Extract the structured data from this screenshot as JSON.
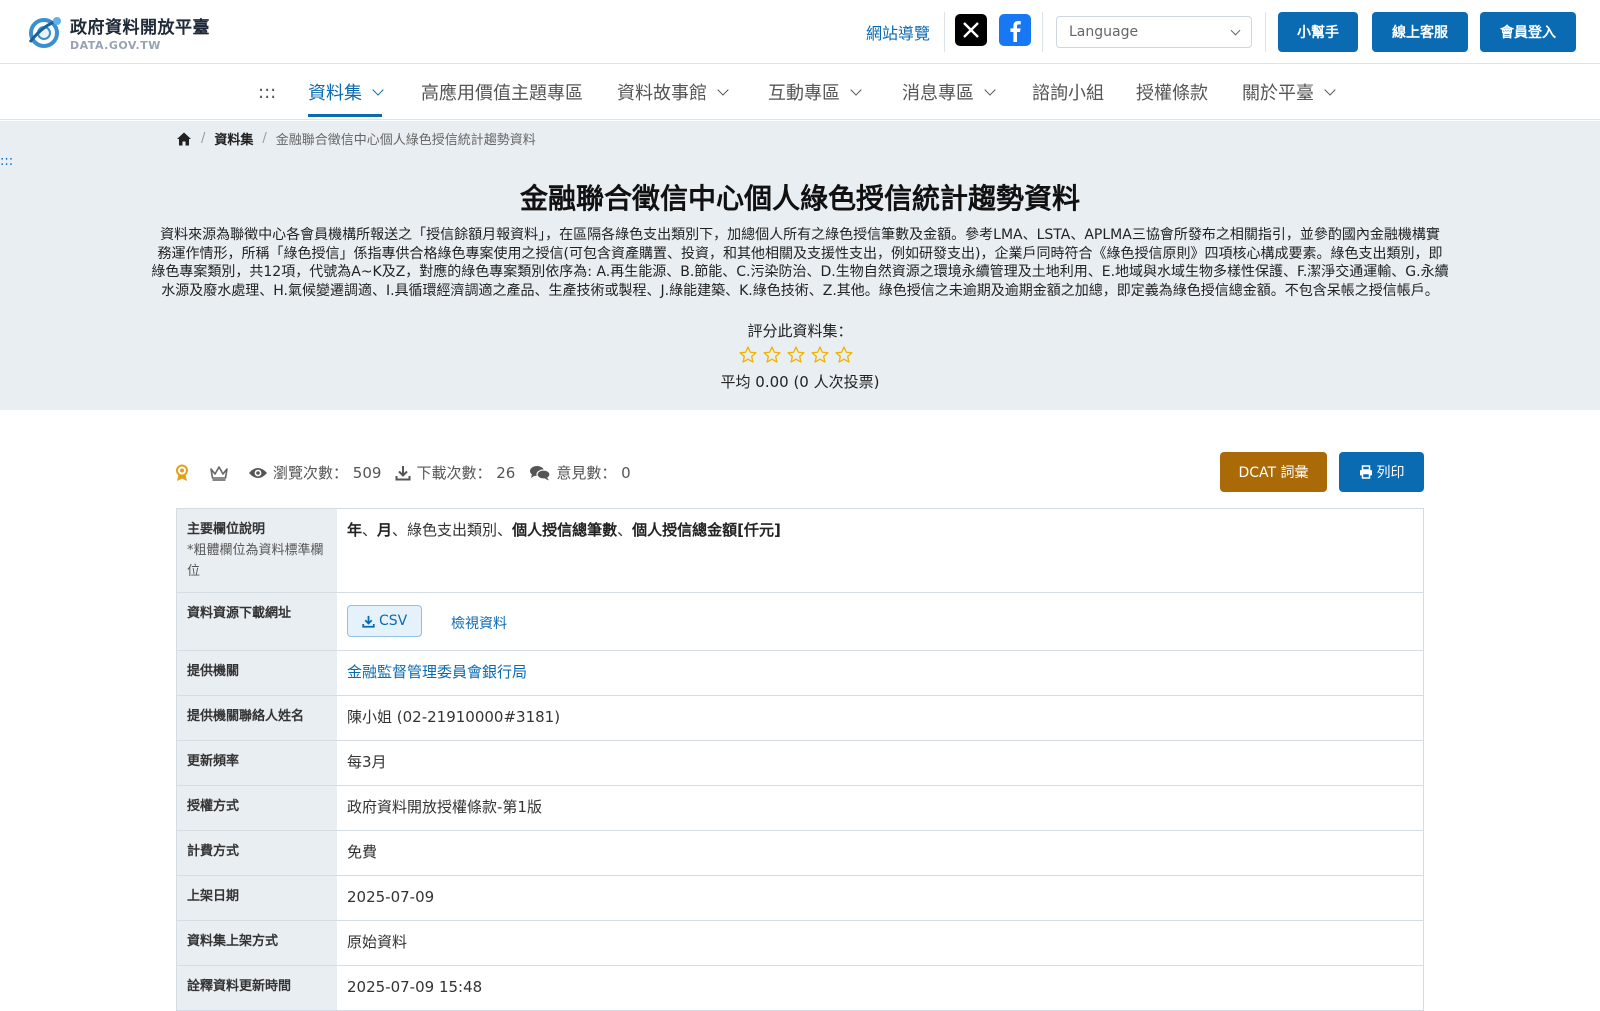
{
  "header": {
    "logo_zh": "政府資料開放平臺",
    "logo_en": "DATA.GOV.TW",
    "sitemap": "網站導覽",
    "language_placeholder": "Language",
    "buttons": {
      "helper": "小幫手",
      "support": "線上客服",
      "login": "會員登入"
    }
  },
  "nav": {
    "accesskey": ":::",
    "items": [
      {
        "label": "資料集"
      },
      {
        "label": "高應用價值主題專區"
      },
      {
        "label": "資料故事館"
      },
      {
        "label": "互動專區"
      },
      {
        "label": "消息專區"
      },
      {
        "label": "諮詢小組"
      },
      {
        "label": "授權條款"
      },
      {
        "label": "關於平臺"
      }
    ]
  },
  "breadcrumb": [
    "資料集",
    "金融聯合徵信中心個人綠色授信統計趨勢資料"
  ],
  "accesskey_left": ":::",
  "dataset": {
    "title": "金融聯合徵信中心個人綠色授信統計趨勢資料",
    "description_lines": [
      "資料來源為聯徵中心各會員機構所報送之「授信餘額月報資料」，在區隔各綠色支出類別下，加總個人所有之綠色授信筆數及金額。參考LMA、LSTA、APLMA三協會所發布之相關指引，並參酌國內金融機構實",
      "務運作情形，所稱「綠色授信」係指專供合格綠色專案使用之授信(可包含資產購置、投資，和其他相關及支援性支出，例如研發支出)，企業戶同時符合《綠色授信原則》四項核心構成要素。綠色支出類別，即",
      "綠色專案類別，共12項，代號為A~K及Z，對應的綠色專案類別依序為: A.再生能源、B.節能、C.污染防治、D.生物自然資源之環境永續管理及土地利用、E.地域與水域生物多樣性保護、F.潔淨交通運輸、G.永續",
      "水源及廢水處理、H.氣候變遷調適、I.具循環經濟調適之產品、生產技術或製程、J.綠能建築、K.綠色技術、Z.其他。綠色授信之未逾期及逾期金額之加總，即定義為綠色授信總金額。不包含呆帳之授信帳戶。"
    ],
    "rating_label": "評分此資料集：",
    "rating": {
      "value": 0,
      "max": 5
    },
    "average_text": "平均 0.00 (0 人次投票)"
  },
  "stats": {
    "views_label": "瀏覽次數：",
    "views": "509",
    "downloads_label": "下載次數：",
    "downloads": "26",
    "comments_label": "意見數：",
    "comments": "0"
  },
  "actions": {
    "dcat": "DCAT 詞彙",
    "print": "列印"
  },
  "details": {
    "fields_key": "主要欄位說明",
    "fields_sub": "*粗體欄位為資料標準欄位",
    "fields_parts": [
      {
        "text": "年",
        "bold": true
      },
      {
        "text": "、",
        "bold": false
      },
      {
        "text": "月",
        "bold": true
      },
      {
        "text": "、綠色支出類別、",
        "bold": false
      },
      {
        "text": "個人授信總筆數",
        "bold": true
      },
      {
        "text": "、",
        "bold": false
      },
      {
        "text": "個人授信總金額[仟元]",
        "bold": true
      }
    ],
    "download_key": "資料資源下載網址",
    "csv_label": "CSV",
    "view_label": "檢視資料",
    "rows": [
      {
        "key": "提供機關",
        "value": "金融監督管理委員會銀行局",
        "link": true
      },
      {
        "key": "提供機關聯絡人姓名",
        "value": "陳小姐 (02-21910000#3181)"
      },
      {
        "key": "更新頻率",
        "value": "每3月"
      },
      {
        "key": "授權方式",
        "value": "政府資料開放授權條款-第1版"
      },
      {
        "key": "計費方式",
        "value": "免費"
      },
      {
        "key": "上架日期",
        "value": "2025-07-09"
      },
      {
        "key": "資料集上架方式",
        "value": "原始資料"
      },
      {
        "key": "詮釋資料更新時間",
        "value": "2025-07-09 15:48"
      }
    ]
  },
  "colors": {
    "primary": "#0a6bb3",
    "dcat": "#a96a07",
    "hero_bg": "#e9eef3",
    "star": "#f0b400"
  }
}
